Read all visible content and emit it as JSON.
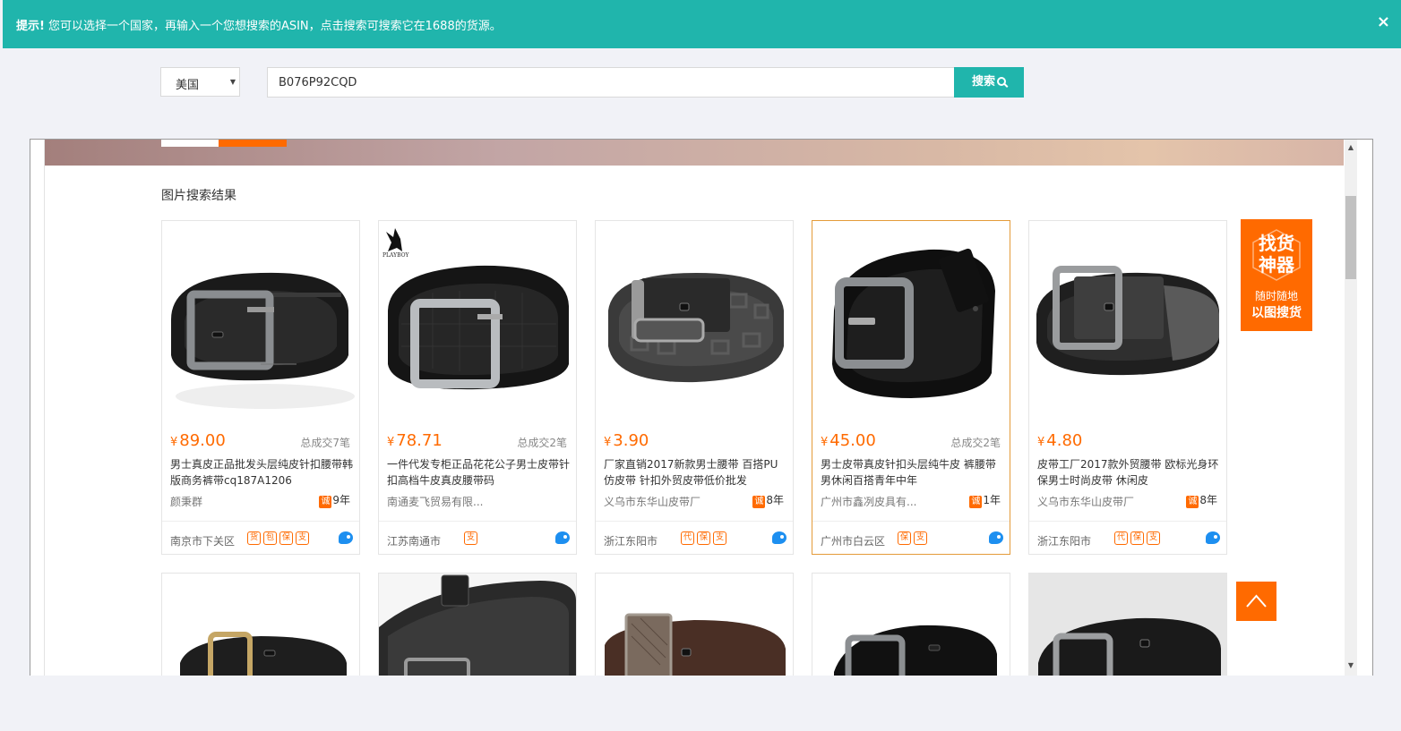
{
  "notice": {
    "label": "提示!",
    "text": "您可以选择一个国家，再输入一个您想搜索的ASIN，点击搜索可搜索它在1688的货源。",
    "close": "×"
  },
  "search": {
    "country": "美国",
    "query": "B076P92CQD",
    "button_label": "搜索"
  },
  "section_title": "图片搜索结果",
  "products": [
    {
      "price": "89.00",
      "sales": "总成交7笔",
      "title": "男士真皮正品批发头层纯皮针扣腰带韩版商务裤带cq187A1206",
      "seller": "颜秉群",
      "years": "9年",
      "location": "南京市下关区",
      "badges": [
        "货",
        "包",
        "保",
        "支"
      ]
    },
    {
      "price": "78.71",
      "sales": "总成交2笔",
      "title": "一件代发专柜正品花花公子男士皮带针扣高档牛皮真皮腰带码",
      "seller": "南通麦飞贸易有限...",
      "years": "",
      "location": "江苏南通市",
      "badges": [
        "支"
      ]
    },
    {
      "price": "3.90",
      "sales": "",
      "title": "厂家直销2017新款男士腰带 百搭PU仿皮带 针扣外贸皮带低价批发",
      "seller": "义乌市东华山皮带厂",
      "years": "8年",
      "location": "浙江东阳市",
      "badges": [
        "代",
        "保",
        "支"
      ]
    },
    {
      "price": "45.00",
      "sales": "总成交2笔",
      "title": "男士皮带真皮针扣头层纯牛皮 裤腰带男休闲百搭青年中年",
      "seller": "广州市鑫冽皮具有...",
      "years": "1年",
      "location": "广州市白云区",
      "badges": [
        "保",
        "支"
      ]
    },
    {
      "price": "4.80",
      "sales": "",
      "title": "皮带工厂2017款外贸腰带 欧标光身环保男士时尚皮带 休闲皮",
      "seller": "义乌市东华山皮带厂",
      "years": "8年",
      "location": "浙江东阳市",
      "badges": [
        "代",
        "保",
        "支"
      ]
    }
  ],
  "brand_label": "PLAYBOY",
  "cheng_badge": "诚",
  "currency": "¥",
  "finder": {
    "big": "找货神器",
    "line1": "随时随地",
    "line2": "以图搜货"
  },
  "colors": {
    "teal": "#20b5ac",
    "orange": "#ff6a00"
  }
}
